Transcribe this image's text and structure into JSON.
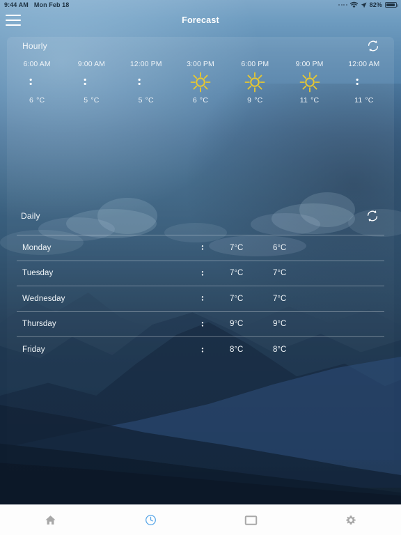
{
  "status_bar": {
    "time": "9:44 AM",
    "date": "Mon Feb 18",
    "battery_percent": "82%",
    "wifi_icon": "wifi-icon",
    "location_icon": "location-arrow-icon",
    "battery_icon": "battery-icon"
  },
  "nav": {
    "menu_icon": "hamburger-menu-icon",
    "title": "Forecast"
  },
  "hourly": {
    "title": "Hourly",
    "refresh_icon": "refresh-icon",
    "entries": [
      {
        "time": "6:00 AM",
        "icon": "moon-icon",
        "temp": "6",
        "unit": "°C"
      },
      {
        "time": "9:00 AM",
        "icon": "moon-icon",
        "temp": "5",
        "unit": "°C"
      },
      {
        "time": "12:00 PM",
        "icon": "moon-icon",
        "temp": "5",
        "unit": "°C"
      },
      {
        "time": "3:00 PM",
        "icon": "sun-icon",
        "temp": "6",
        "unit": "°C"
      },
      {
        "time": "6:00 PM",
        "icon": "sun-icon",
        "temp": "9",
        "unit": "°C"
      },
      {
        "time": "9:00 PM",
        "icon": "sun-icon",
        "temp": "11",
        "unit": "°C"
      },
      {
        "time": "12:00 AM",
        "icon": "moon-icon",
        "temp": "11",
        "unit": "°C"
      }
    ]
  },
  "daily": {
    "title": "Daily",
    "refresh_icon": "refresh-icon",
    "entries": [
      {
        "day": "Monday",
        "icon": "moon-icon",
        "high": "7°C",
        "low": "6°C"
      },
      {
        "day": "Tuesday",
        "icon": "moon-icon",
        "high": "7°C",
        "low": "7°C"
      },
      {
        "day": "Wednesday",
        "icon": "moon-icon",
        "high": "7°C",
        "low": "7°C"
      },
      {
        "day": "Thursday",
        "icon": "moon-icon",
        "high": "9°C",
        "low": "9°C"
      },
      {
        "day": "Friday",
        "icon": "moon-icon",
        "high": "8°C",
        "low": "8°C"
      }
    ]
  },
  "tabbar": {
    "items": [
      {
        "icon": "home-icon",
        "active": false
      },
      {
        "icon": "clock-icon",
        "active": true
      },
      {
        "icon": "card-icon",
        "active": false
      },
      {
        "icon": "settings-gear-icon",
        "active": false
      }
    ],
    "active_color": "#58a6e8",
    "inactive_color": "#a8a8a8"
  },
  "colors": {
    "sun": "#e8c830",
    "moon": "#ffffff",
    "text": "#f0f5f8",
    "accent": "#58a6e8"
  }
}
